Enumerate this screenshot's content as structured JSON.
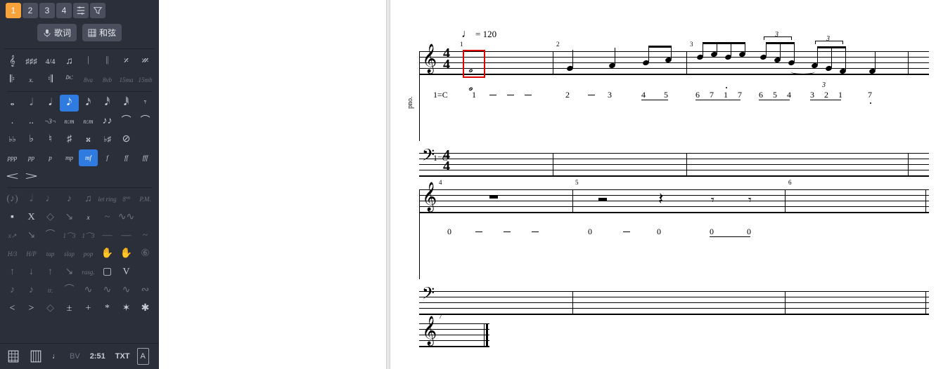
{
  "tabs": {
    "t1": "1",
    "t2": "2",
    "t3": "3",
    "t4": "4"
  },
  "buttons": {
    "lyrics": "歌词",
    "chord": "和弦"
  },
  "palette": {
    "r1": [
      "𝄞",
      "♯♯♯",
      "4/4",
      "♫",
      "𝄀",
      "𝄁",
      "𝄎",
      "𝄏"
    ],
    "r2": [
      "𝄆",
      "x.",
      "𝄇",
      "𝄊",
      "8va",
      "8vb",
      "15ma",
      "15mb"
    ],
    "r3": [
      "𝅝",
      "𝅗𝅥",
      "𝅘𝅥",
      "𝅘𝅥𝅮",
      "𝅘𝅥𝅯",
      "𝅘𝅥𝅰",
      "𝅘𝅥𝅱",
      "𝄾"
    ],
    "r4": [
      ".",
      "..",
      "¬3¬",
      "n:m",
      "n:m",
      "♪♪",
      "⌒",
      "⌒"
    ],
    "r5": [
      "♭♭",
      "♭",
      "♮",
      "♯",
      "𝄪",
      "♭♯",
      "⊘",
      ""
    ],
    "r6": [
      "ppp",
      "pp",
      "p",
      "mp",
      "mf",
      "f",
      "ff",
      "fff"
    ],
    "r7": [
      "<",
      ">",
      "",
      "",
      "",
      "",
      "",
      ""
    ],
    "r8": [
      "(♪)",
      "𝅗𝅥",
      "♩",
      "♪",
      "♫",
      "let ring",
      "𝄶",
      "P.M."
    ],
    "r9": [
      "▪",
      "X",
      "◇",
      "↘",
      "x",
      "~",
      "∿∿"
    ],
    "r10": [
      "x↗",
      "↘",
      "⌒",
      "1⌒3",
      "1⌒3",
      "—",
      "—",
      "~"
    ],
    "r11": [
      "H/3",
      "H/P",
      "tap",
      "slap",
      "pop",
      "✋",
      "✋",
      "⑥"
    ],
    "r12": [
      "↑",
      "↓",
      "↑",
      "↘",
      "rasg.",
      "▢",
      "V",
      ""
    ],
    "r13": [
      "♪",
      "♪",
      "tr.",
      "⌒",
      "∿",
      "∿",
      "∿",
      "∾"
    ],
    "r14": [
      "<",
      ">",
      "◇",
      "±",
      "+",
      "*",
      "✶",
      "✱"
    ]
  },
  "bottom": {
    "bv": "BV",
    "time": "2:51",
    "txt": "TXT",
    "a": "A"
  },
  "score": {
    "tempo": "= 120",
    "instrument": "pno.",
    "key": "1=C",
    "timesig_top": "4",
    "timesig_bot": "4",
    "measures": {
      "m1": "1",
      "m2": "2",
      "m3": "3",
      "m4": "4",
      "m5": "5",
      "m6": "6",
      "m7": "7"
    },
    "jianpu_sys1": [
      "1",
      "—",
      "—",
      "—",
      "2",
      "—",
      "3",
      "4",
      "5",
      "6",
      "7",
      "1",
      "7",
      "6",
      "5",
      "4",
      "3",
      "2",
      "1",
      "7"
    ],
    "jianpu_sys2": [
      "0",
      "—",
      "—",
      "—",
      "0",
      "—",
      "0",
      "0",
      "0"
    ],
    "triplet": "3"
  },
  "chart_data": null
}
